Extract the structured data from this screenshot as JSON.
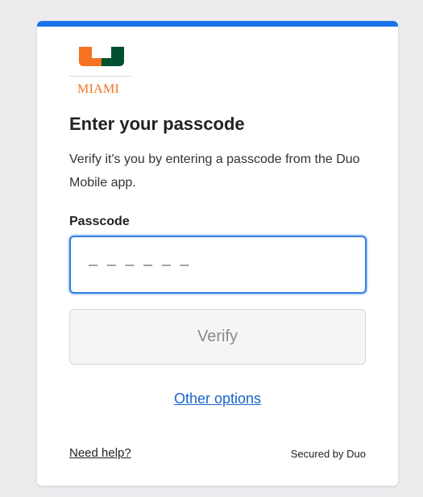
{
  "brand": {
    "logo_text": "MIAMI",
    "colors": {
      "orange": "#f47321",
      "green": "#005030",
      "accent_bar": "#1a73e8"
    }
  },
  "prompt": {
    "title": "Enter your passcode",
    "description": "Verify it's you by entering a passcode from the Duo Mobile app."
  },
  "passcode": {
    "label": "Passcode",
    "value": "",
    "placeholder": "– – – – – –"
  },
  "actions": {
    "verify_label": "Verify",
    "other_options_label": "Other options"
  },
  "footer": {
    "help_label": "Need help?",
    "secured_by": "Secured by Duo"
  }
}
